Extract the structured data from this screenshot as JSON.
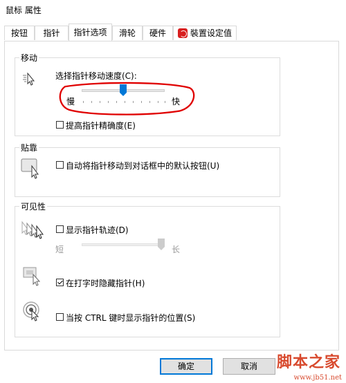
{
  "window": {
    "title": "鼠标 属性"
  },
  "tabs": [
    {
      "label": "按钮"
    },
    {
      "label": "指针"
    },
    {
      "label": "指针选项",
      "active": true
    },
    {
      "label": "滑轮"
    },
    {
      "label": "硬件"
    },
    {
      "label": "裝置设定值",
      "icon": "device-settings-icon"
    }
  ],
  "motion": {
    "title": "移动",
    "speed_label": "选择指针移动速度(C):",
    "slow_label": "慢",
    "fast_label": "快",
    "speed_level": 0.55,
    "precision_label": "提高指针精确度(E)",
    "precision_checked": false
  },
  "snap": {
    "title": "贴靠",
    "snap_label": "自动将指针移动到对话框中的默认按钮(U)",
    "snap_checked": false
  },
  "visibility": {
    "title": "可见性",
    "trails_label": "显示指针轨迹(D)",
    "trails_checked": false,
    "short_label": "短",
    "long_label": "长",
    "trails_level": 1.0,
    "hide_typing_label": "在打字时隐藏指针(H)",
    "hide_typing_checked": true,
    "ctrl_label": "当按 CTRL 键时显示指针的位置(S)",
    "ctrl_checked": false
  },
  "buttons": {
    "ok": "确定",
    "cancel": "取消"
  },
  "watermark": {
    "brand": "脚本之家",
    "url": "www.jb51.net"
  },
  "colors": {
    "accent": "#0078d7",
    "annotation": "#e00000"
  }
}
